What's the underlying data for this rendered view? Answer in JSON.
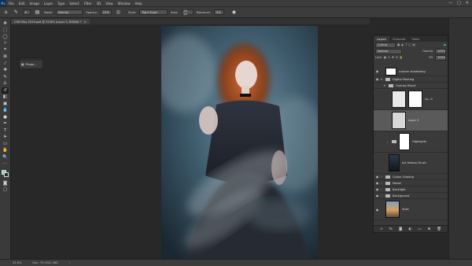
{
  "menubar": {
    "logo": "Ps",
    "items": [
      "File",
      "Edit",
      "Image",
      "Layer",
      "Type",
      "Select",
      "Filter",
      "3D",
      "View",
      "Window",
      "Help"
    ],
    "window_controls": [
      "—",
      "□",
      "✕"
    ]
  },
  "options": {
    "mode_label": "Mode:",
    "mode_value": "Normal",
    "opacity_label": "Opacity:",
    "opacity_value": "22%",
    "style_label": "Style:",
    "style_value": "Tight Short",
    "area_label": "Area:",
    "area_value": "20 px",
    "tolerance_label": "Tolerance:",
    "tolerance_value": "0%"
  },
  "document_tab": {
    "title": "CSM May 2019.psd @ 33.6% (Layer 5, RGB/8) *",
    "close": "×"
  },
  "properties": {
    "label": "Prope..."
  },
  "layers_panel": {
    "tabs": [
      "Layers",
      "Channels",
      "Paths"
    ],
    "filter_label": "Q Kind",
    "blend_mode": "Normal",
    "opacity_label": "Opacity:",
    "opacity_value": "100%",
    "lock_label": "Lock:",
    "fill_label": "Fill:",
    "fill_value": "100%",
    "layers": [
      {
        "name": "custom shadowing",
        "kind": "pixel",
        "thumb": "white"
      },
      {
        "name": "Digital Painting",
        "kind": "group"
      },
      {
        "name": "Overlay Blend",
        "kind": "group"
      },
      {
        "name": "Lo...h",
        "kind": "pixel",
        "thumb": "white"
      },
      {
        "name": "Layer 5",
        "kind": "pixel",
        "thumb": "grey",
        "selected": true
      },
      {
        "name": "Highlights",
        "kind": "group",
        "thumb": "white"
      },
      {
        "name": "Art History Brush",
        "kind": "pixel",
        "thumb": "photo"
      },
      {
        "name": "Colour Grading",
        "kind": "group"
      },
      {
        "name": "Model",
        "kind": "group"
      },
      {
        "name": "Backlight",
        "kind": "group"
      },
      {
        "name": "Background",
        "kind": "group"
      },
      {
        "name": "Start",
        "kind": "pixel",
        "thumb": "landscape"
      }
    ],
    "bottom_icons": [
      "link-icon",
      "fx-icon",
      "mask-icon",
      "adjustment-icon",
      "folder-icon",
      "new-layer-icon",
      "trash-icon"
    ]
  },
  "status": {
    "zoom": "33.6%",
    "doc": "Doc: 79.1M/1.36G"
  },
  "colors": {
    "foreground": "#7fd9c1",
    "background": "#1b2e33",
    "accent": "#31a8ff"
  }
}
